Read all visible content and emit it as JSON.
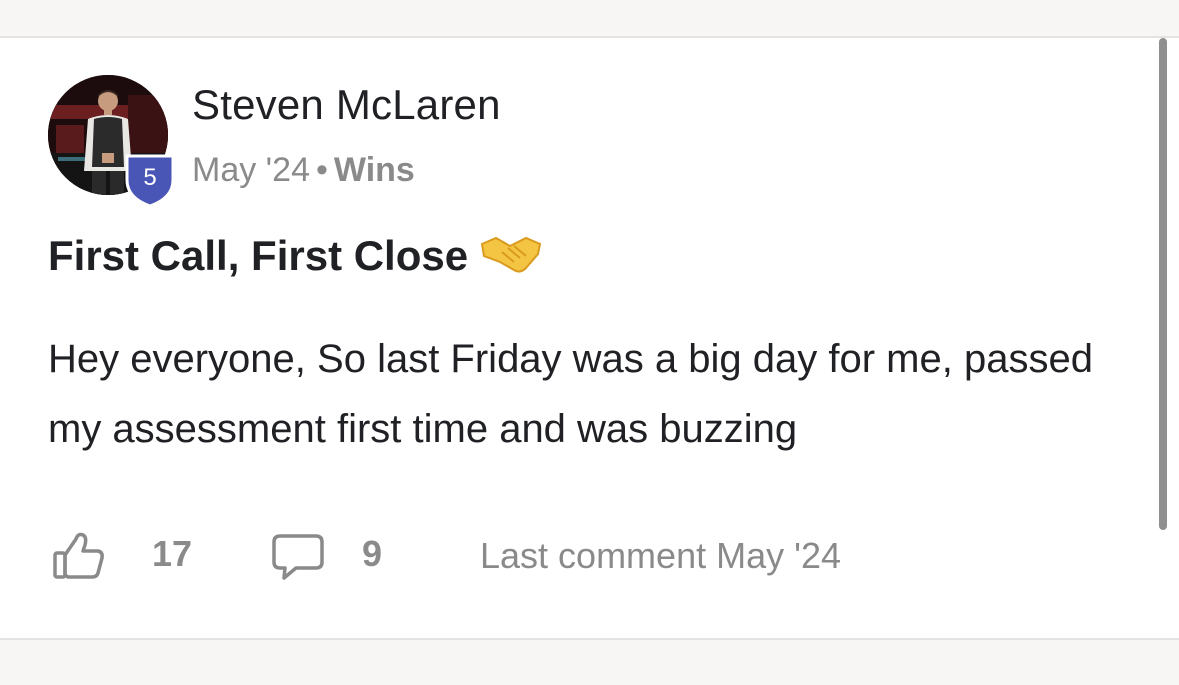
{
  "post": {
    "author": "Steven McLaren",
    "level": "5",
    "date": "May '24",
    "separator": "•",
    "category": "Wins",
    "title": "First Call, First Close",
    "title_emoji": "handshake-emoji",
    "body": "Hey everyone, So last Friday was a big day for me, passed my assessment first time and was buzzing",
    "likes": "17",
    "comments": "9",
    "last_comment": "Last comment May '24"
  },
  "colors": {
    "badge": "#4a56b5",
    "muted_text": "#8a8a8a",
    "primary_text": "#202124",
    "page_bg": "#f7f6f4",
    "card_bg": "#ffffff"
  },
  "icons": {
    "like": "thumbs-up-icon",
    "comment": "comment-icon"
  }
}
